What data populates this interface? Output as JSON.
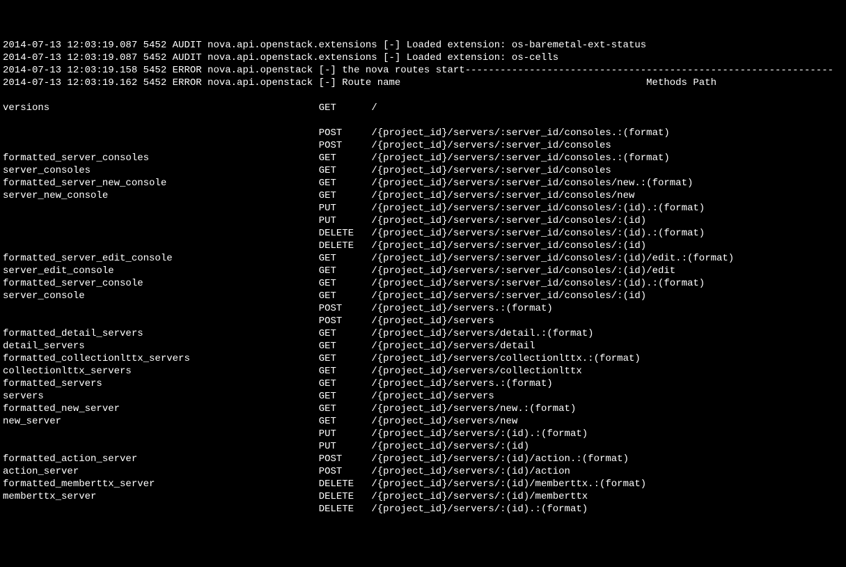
{
  "log_lines": [
    "2014-07-13 12:03:19.087 5452 AUDIT nova.api.openstack.extensions [-] Loaded extension: os-baremetal-ext-status",
    "2014-07-13 12:03:19.087 5452 AUDIT nova.api.openstack.extensions [-] Loaded extension: os-cells",
    "2014-07-13 12:03:19.158 5452 ERROR nova.api.openstack [-] the nova routes start---------------------------------------------------------------",
    "2014-07-13 12:03:19.162 5452 ERROR nova.api.openstack [-] Route name                                          Methods Path"
  ],
  "routes": [
    {
      "name": "",
      "method": "",
      "path": ""
    },
    {
      "name": "versions",
      "method": "GET",
      "path": "/"
    },
    {
      "name": "",
      "method": "",
      "path": ""
    },
    {
      "name": "",
      "method": "POST",
      "path": "/{project_id}/servers/:server_id/consoles.:(format)"
    },
    {
      "name": "",
      "method": "POST",
      "path": "/{project_id}/servers/:server_id/consoles"
    },
    {
      "name": "formatted_server_consoles",
      "method": "GET",
      "path": "/{project_id}/servers/:server_id/consoles.:(format)"
    },
    {
      "name": "server_consoles",
      "method": "GET",
      "path": "/{project_id}/servers/:server_id/consoles"
    },
    {
      "name": "formatted_server_new_console",
      "method": "GET",
      "path": "/{project_id}/servers/:server_id/consoles/new.:(format)"
    },
    {
      "name": "server_new_console",
      "method": "GET",
      "path": "/{project_id}/servers/:server_id/consoles/new"
    },
    {
      "name": "",
      "method": "PUT",
      "path": "/{project_id}/servers/:server_id/consoles/:(id).:(format)"
    },
    {
      "name": "",
      "method": "PUT",
      "path": "/{project_id}/servers/:server_id/consoles/:(id)"
    },
    {
      "name": "",
      "method": "DELETE",
      "path": "/{project_id}/servers/:server_id/consoles/:(id).:(format)"
    },
    {
      "name": "",
      "method": "DELETE",
      "path": "/{project_id}/servers/:server_id/consoles/:(id)"
    },
    {
      "name": "formatted_server_edit_console",
      "method": "GET",
      "path": "/{project_id}/servers/:server_id/consoles/:(id)/edit.:(format)"
    },
    {
      "name": "server_edit_console",
      "method": "GET",
      "path": "/{project_id}/servers/:server_id/consoles/:(id)/edit"
    },
    {
      "name": "formatted_server_console",
      "method": "GET",
      "path": "/{project_id}/servers/:server_id/consoles/:(id).:(format)"
    },
    {
      "name": "server_console",
      "method": "GET",
      "path": "/{project_id}/servers/:server_id/consoles/:(id)"
    },
    {
      "name": "",
      "method": "POST",
      "path": "/{project_id}/servers.:(format)"
    },
    {
      "name": "",
      "method": "POST",
      "path": "/{project_id}/servers"
    },
    {
      "name": "formatted_detail_servers",
      "method": "GET",
      "path": "/{project_id}/servers/detail.:(format)"
    },
    {
      "name": "detail_servers",
      "method": "GET",
      "path": "/{project_id}/servers/detail"
    },
    {
      "name": "formatted_collectionlttx_servers",
      "method": "GET",
      "path": "/{project_id}/servers/collectionlttx.:(format)"
    },
    {
      "name": "collectionlttx_servers",
      "method": "GET",
      "path": "/{project_id}/servers/collectionlttx"
    },
    {
      "name": "formatted_servers",
      "method": "GET",
      "path": "/{project_id}/servers.:(format)"
    },
    {
      "name": "servers",
      "method": "GET",
      "path": "/{project_id}/servers"
    },
    {
      "name": "formatted_new_server",
      "method": "GET",
      "path": "/{project_id}/servers/new.:(format)"
    },
    {
      "name": "new_server",
      "method": "GET",
      "path": "/{project_id}/servers/new"
    },
    {
      "name": "",
      "method": "PUT",
      "path": "/{project_id}/servers/:(id).:(format)"
    },
    {
      "name": "",
      "method": "PUT",
      "path": "/{project_id}/servers/:(id)"
    },
    {
      "name": "formatted_action_server",
      "method": "POST",
      "path": "/{project_id}/servers/:(id)/action.:(format)"
    },
    {
      "name": "action_server",
      "method": "POST",
      "path": "/{project_id}/servers/:(id)/action"
    },
    {
      "name": "formatted_memberttx_server",
      "method": "DELETE",
      "path": "/{project_id}/servers/:(id)/memberttx.:(format)"
    },
    {
      "name": "memberttx_server",
      "method": "DELETE",
      "path": "/{project_id}/servers/:(id)/memberttx"
    },
    {
      "name": "",
      "method": "DELETE",
      "path": "/{project_id}/servers/:(id).:(format)"
    }
  ],
  "columns": {
    "name_width": 54,
    "method_width": 9
  }
}
